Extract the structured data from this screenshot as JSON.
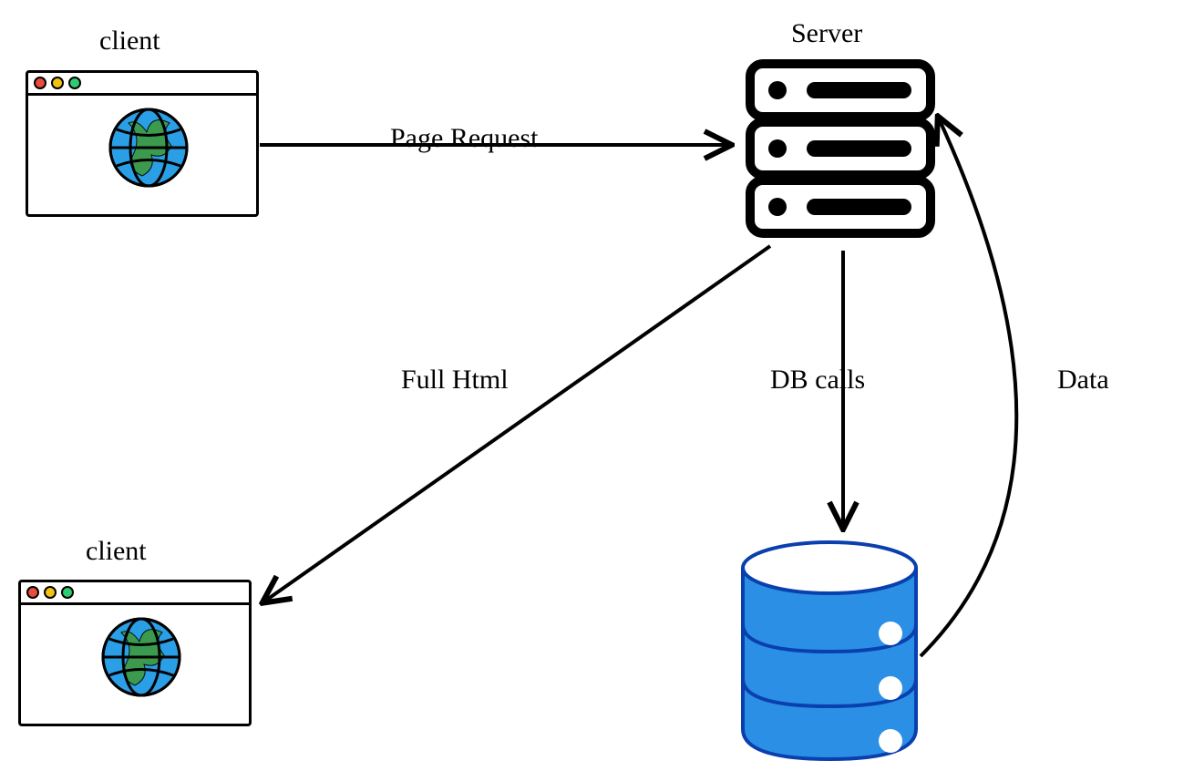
{
  "labels": {
    "client_top": "client",
    "client_bottom": "client",
    "server": "Server",
    "page_request": "Page Request",
    "full_html": "Full Html",
    "db_calls": "DB calls",
    "data": "Data"
  },
  "colors": {
    "globe_fill": "#2B9FE6",
    "globe_land": "#3E9A3E",
    "db_fill": "#2B8FE6",
    "db_stroke": "#0A3FAE",
    "black": "#000000"
  },
  "diagram": {
    "nodes": [
      {
        "id": "client_top",
        "type": "browser",
        "label": "client"
      },
      {
        "id": "client_bottom",
        "type": "browser",
        "label": "client"
      },
      {
        "id": "server",
        "type": "server",
        "label": "Server"
      },
      {
        "id": "database",
        "type": "database",
        "label": ""
      }
    ],
    "edges": [
      {
        "from": "client_top",
        "to": "server",
        "label": "Page Request"
      },
      {
        "from": "server",
        "to": "client_bottom",
        "label": "Full Html"
      },
      {
        "from": "server",
        "to": "database",
        "label": "DB calls"
      },
      {
        "from": "database",
        "to": "server",
        "label": "Data",
        "curved": true
      }
    ]
  }
}
